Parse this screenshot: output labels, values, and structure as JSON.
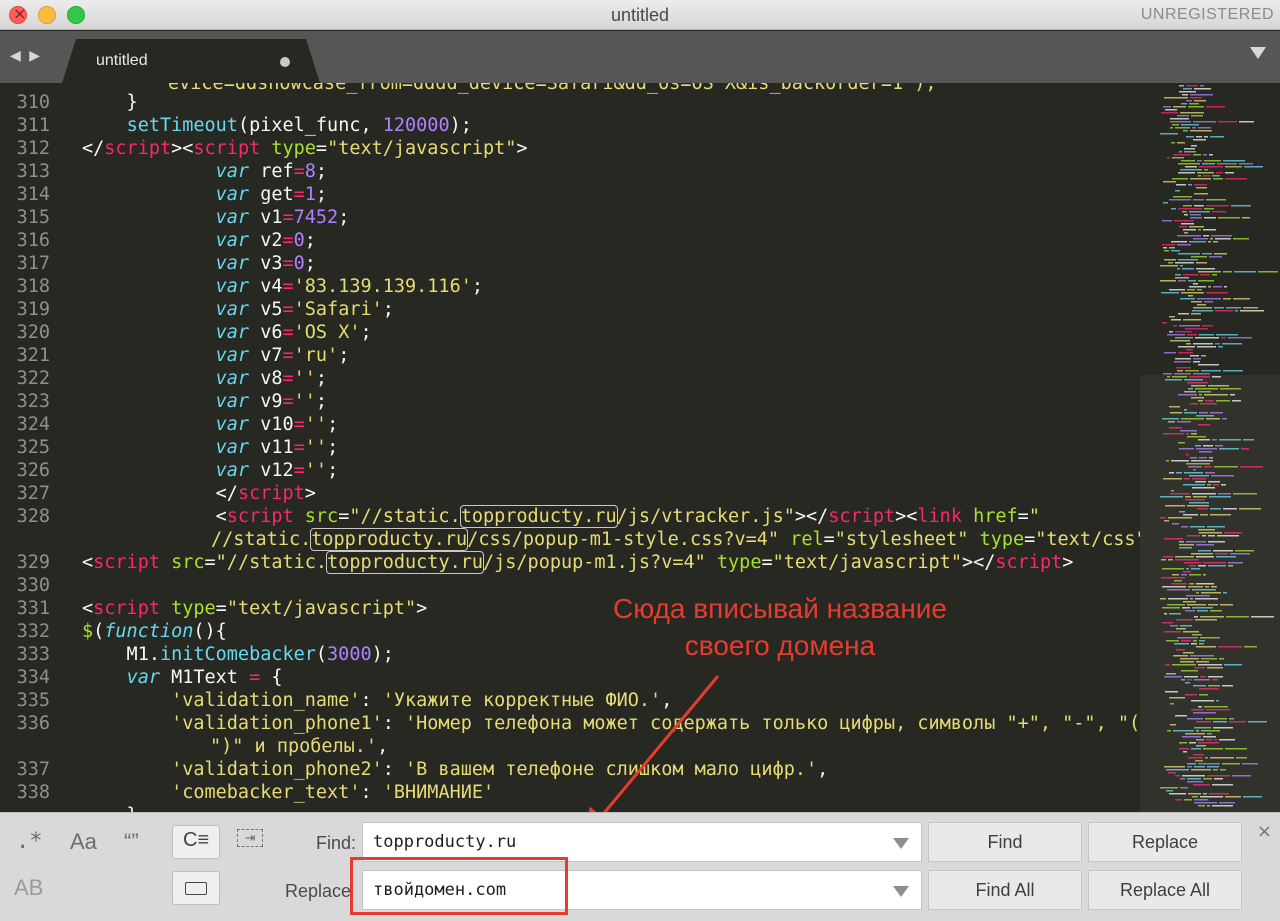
{
  "window": {
    "title": "untitled",
    "license_status": "UNREGISTERED"
  },
  "tabbar": {
    "nav": "◀ ▶",
    "active_tab": "untitled"
  },
  "editor": {
    "line_numbers": [
      "310",
      "311",
      "312",
      "313",
      "314",
      "315",
      "316",
      "317",
      "318",
      "319",
      "320",
      "321",
      "322",
      "323",
      "324",
      "325",
      "326",
      "327",
      "328",
      "",
      "329",
      "330",
      "331",
      "332",
      "333",
      "334",
      "335",
      "336",
      "",
      "337",
      "338"
    ],
    "partial_top_line": "evice=ddshowcase_from=dddd_device=Safari&dd_os=OS X&is_backorder=1\");"
  },
  "annotation": {
    "line1": "Сюда вписывай название",
    "line2": "своего домена",
    "color": "#e63c2f"
  },
  "find_panel": {
    "options": {
      "regex": ".*",
      "case": "Aa",
      "whole_word": "“”",
      "wrap": "C≡",
      "in_selection": "⇥",
      "preserve_case": "AB"
    },
    "find_label": "Find:",
    "find_value": "topproducty.ru",
    "replace_label": "Replace",
    "replace_value": "твойдомен.com",
    "buttons": {
      "find": "Find",
      "replace": "Replace",
      "find_all": "Find All",
      "replace_all": "Replace All"
    },
    "close": "×"
  }
}
